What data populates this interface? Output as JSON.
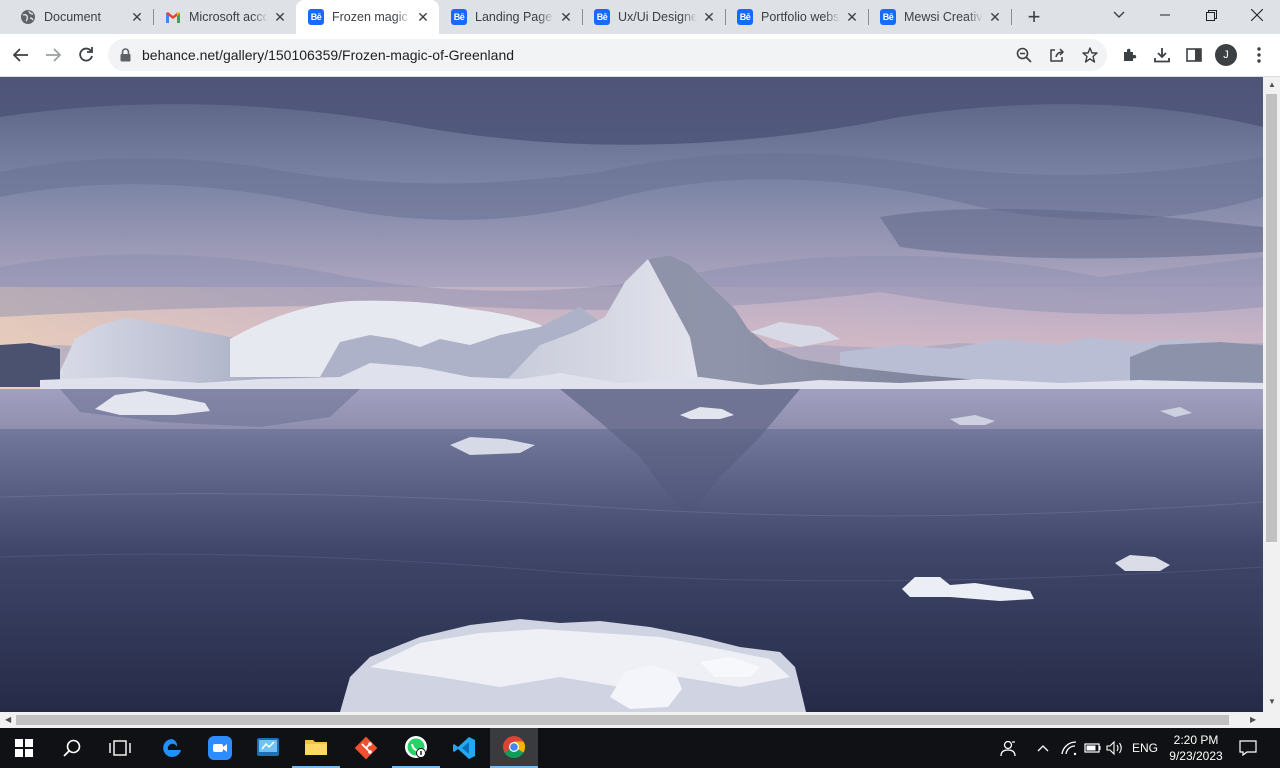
{
  "browser": {
    "tabs": [
      {
        "title": "Document",
        "icon": "globe-icon",
        "active": false
      },
      {
        "title": "Microsoft account",
        "icon": "gmail-icon",
        "active": false
      },
      {
        "title": "Frozen magic of Greenland",
        "icon": "behance-icon",
        "active": true
      },
      {
        "title": "Landing Page - Mobile",
        "icon": "behance-icon",
        "active": false
      },
      {
        "title": "Ux/Ui Designer",
        "icon": "behance-icon",
        "active": false
      },
      {
        "title": "Portfolio website",
        "icon": "behance-icon",
        "active": false
      },
      {
        "title": "Mewsi Creative",
        "icon": "behance-icon",
        "active": false
      }
    ],
    "favicon_text": "Bē",
    "new_tab_label": "+",
    "close_glyph": "✕",
    "address": "behance.net/gallery/150106359/Frozen-magic-of-Greenland",
    "profile_initial": "J"
  },
  "page": {
    "image_subject": "iceberg-photo"
  },
  "taskbar": {
    "language": "ENG",
    "time": "2:20 PM",
    "date": "9/23/2023"
  },
  "colors": {
    "accent": "#1769ff",
    "taskbar": "#101114",
    "tabstrip": "#dee1e6"
  }
}
